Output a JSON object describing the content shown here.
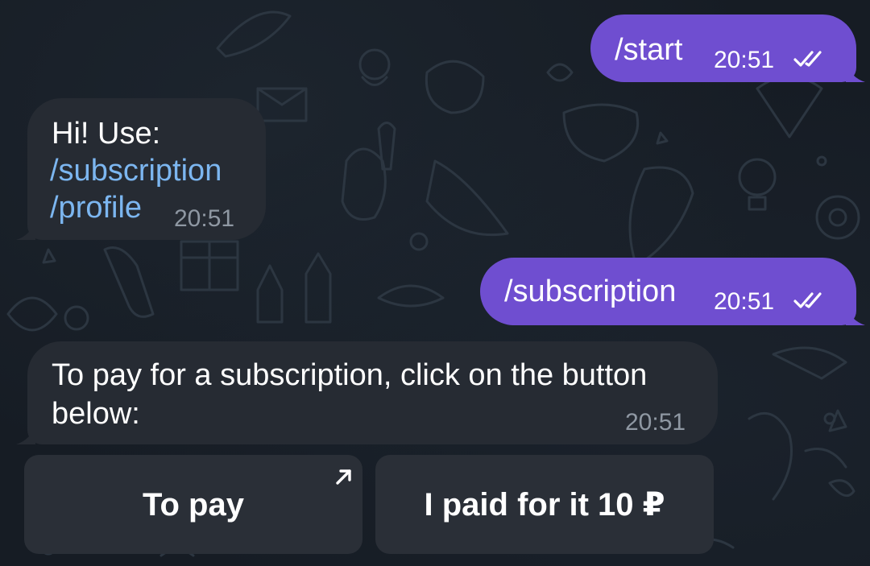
{
  "chat": {
    "messages": [
      {
        "direction": "outgoing",
        "text": "/start",
        "time": "20:51",
        "status": "read",
        "status_icon": "double-check-icon"
      },
      {
        "direction": "incoming",
        "lines": [
          "Hi! Use:",
          "/subscription",
          "/profile"
        ],
        "link_lines": [
          "/subscription",
          "/profile"
        ],
        "time": "20:51"
      },
      {
        "direction": "outgoing",
        "text": "/subscription",
        "time": "20:51",
        "status": "read",
        "status_icon": "double-check-icon"
      },
      {
        "direction": "incoming",
        "lines": [
          "To pay for a subscription, click on the button",
          "below:"
        ],
        "time": "20:51"
      }
    ],
    "inline_keyboard": [
      {
        "label": "To pay",
        "icon": "external-link-arrow-icon"
      },
      {
        "label": "I paid for it 10 ₽"
      }
    ]
  },
  "colors": {
    "background": "#161c24",
    "outgoing_bubble": "#6f4ed0",
    "incoming_bubble": "#262b33",
    "link": "#7cb6f0",
    "inline_button": "#2a2f37",
    "incoming_time": "#8f98a3"
  }
}
